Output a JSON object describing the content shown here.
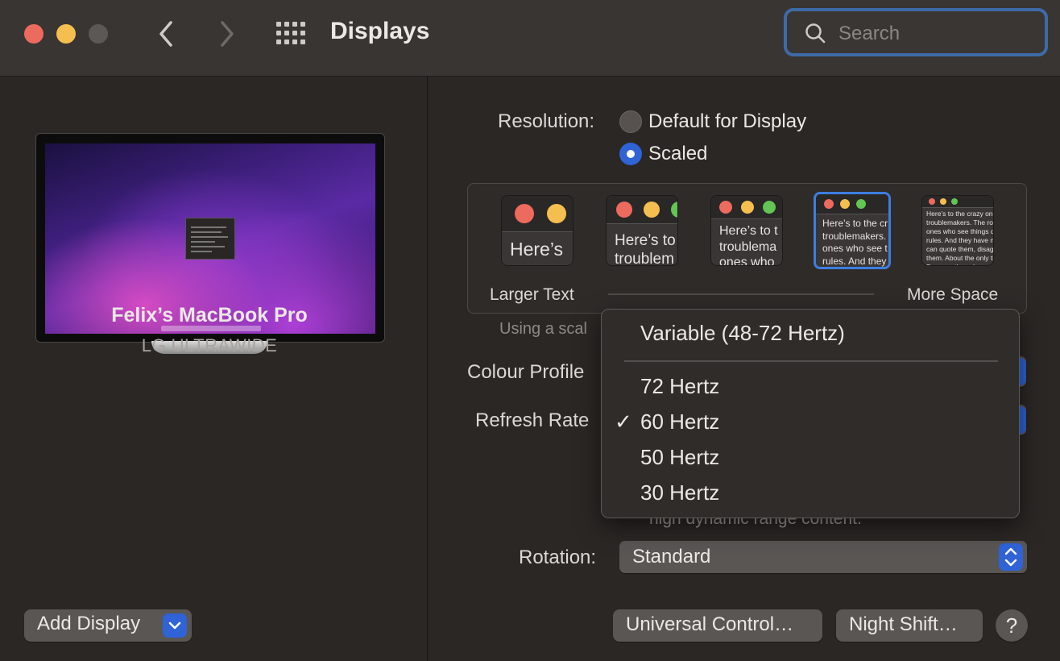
{
  "window": {
    "title": "Displays",
    "traffic_lights": {
      "close": "#ed6a5e",
      "minimize": "#f5bf4f",
      "zoom": "#5c5856"
    },
    "nav": {
      "back_icon": "chevron-left-icon",
      "forward_icon": "chevron-right-icon",
      "grid_icon": "grid-icon"
    },
    "search": {
      "placeholder": "Search",
      "value": ""
    }
  },
  "device": {
    "name": "Felix’s MacBook Pro",
    "model": "LG ULTRAWIDE",
    "add_display_label": "Add Display"
  },
  "settings": {
    "resolution_label": "Resolution:",
    "resolution_options": [
      {
        "label": "Default for Display",
        "selected": false
      },
      {
        "label": "Scaled",
        "selected": true
      }
    ],
    "scale_options": [
      {
        "preview": "Here’s"
      },
      {
        "preview": "Here’s to\ntroublem"
      },
      {
        "preview": "Here’s to t\ntroublema\nones who"
      },
      {
        "preview": "Here’s to the cr\ntroublemakers.\nones who see t\nrules. And they"
      },
      {
        "preview": "Here’s to the crazy ones\ntroublemakers. The rou\nones who see things diff\nrules. And they have no\ncan quote them, disagre\nthem. About the only th\nBecause they change th"
      }
    ],
    "selected_scale_index": 3,
    "scale_left_label": "Larger Text",
    "scale_right_label": "More Space",
    "scale_note": "Using a scal",
    "colour_profile_label": "Colour Profile",
    "refresh_rate_label": "Refresh Rate",
    "hdr_note": "high dynamic range content.",
    "rotation_label": "Rotation:",
    "rotation_value": "Standard"
  },
  "refresh_menu": {
    "header": "Variable (48-72 Hertz)",
    "items": [
      {
        "label": "72 Hertz",
        "checked": false
      },
      {
        "label": "60 Hertz",
        "checked": true
      },
      {
        "label": "50 Hertz",
        "checked": false
      },
      {
        "label": "30 Hertz",
        "checked": false
      }
    ],
    "check_glyph": "✓"
  },
  "footer": {
    "universal_control_label": "Universal Control…",
    "night_shift_label": "Night Shift…",
    "help_label": "?"
  },
  "colors": {
    "accent": "#2f63d6",
    "selection_border": "#3e7de0"
  }
}
